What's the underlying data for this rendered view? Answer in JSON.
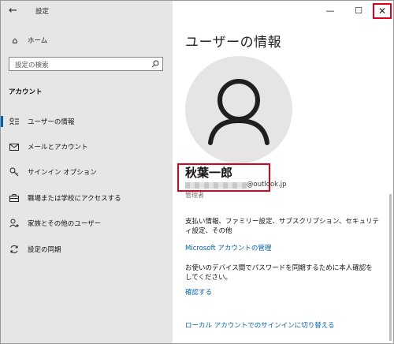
{
  "window": {
    "title": "設定",
    "buttons": {
      "minimize": "—",
      "maximize": "☐",
      "close": "✕"
    }
  },
  "sidebar": {
    "home_label": "ホーム",
    "search_placeholder": "設定の検索",
    "section_label": "アカウント",
    "items": [
      {
        "label": "ユーザーの情報",
        "icon": "user-info-icon",
        "active": true
      },
      {
        "label": "メールとアカウント",
        "icon": "mail-icon",
        "active": false
      },
      {
        "label": "サインイン オプション",
        "icon": "key-icon",
        "active": false
      },
      {
        "label": "職場または学校にアクセスする",
        "icon": "briefcase-icon",
        "active": false
      },
      {
        "label": "家族とその他のユーザー",
        "icon": "add-person-icon",
        "active": false
      },
      {
        "label": "設定の同期",
        "icon": "sync-icon",
        "active": false
      }
    ]
  },
  "main": {
    "title": "ユーザーの情報",
    "user_name": "秋葉一郎",
    "email_suffix": "@outlook.jp",
    "role": "管理者",
    "billing_text": "支払い情報、ファミリー設定、サブスクリプション、セキュリティ設定、その他",
    "manage_link": "Microsoft アカウントの管理",
    "verify_text": "お使いのデバイス間でパスワードを同期するために本人確認をしてください。",
    "verify_link": "確認する",
    "local_link": "ローカル アカウントでのサインインに切り替える"
  },
  "colors": {
    "accent": "#0063b1",
    "highlight_box": "#e0001a",
    "sidebar_bg": "#e6e6e6"
  }
}
